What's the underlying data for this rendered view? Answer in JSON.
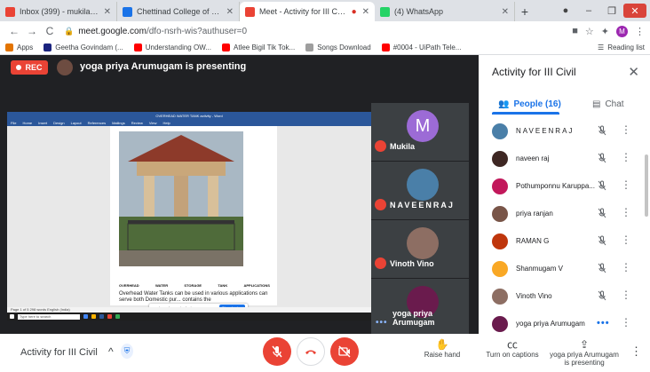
{
  "browser": {
    "tabs": [
      {
        "title": "Inbox (399) - mukila@chettinad.c",
        "icon_color": "#ea4335",
        "active": false
      },
      {
        "title": "Chettinad College of Engineering",
        "icon_color": "#1a73e8",
        "active": false
      },
      {
        "title": "Meet - Activity for III Civil",
        "icon_color": "#ea4335",
        "active": true
      },
      {
        "title": "(4) WhatsApp",
        "icon_color": "#25d366",
        "active": false
      }
    ],
    "url_host": "meet.google.com",
    "url_path": "/dfo-nsrh-wis?authuser=0",
    "profile_letter": "M",
    "bookmarks": [
      {
        "label": "Apps",
        "icon_color": "#e37400"
      },
      {
        "label": "Geetha Govindam (...",
        "icon_color": "#1a237e"
      },
      {
        "label": "Understanding OW...",
        "icon_color": "#ff0000"
      },
      {
        "label": "Atlee Bigil Tik Tok...",
        "icon_color": "#ff0000"
      },
      {
        "label": "Songs Download",
        "icon_color": "#9e9e9e"
      },
      {
        "label": "#0004 - UiPath Tele...",
        "icon_color": "#ff0000"
      }
    ],
    "reading_list": "Reading list"
  },
  "meet": {
    "rec_label": "REC",
    "presenting_text": "yoga priya Arumugam is presenting",
    "meeting_name": "Activity for III Civil"
  },
  "shared_screen": {
    "word_title": "OVERHEAD WATER TANK activity - Word",
    "menu": [
      "File",
      "Home",
      "Insert",
      "Design",
      "Layout",
      "References",
      "Mailings",
      "Review",
      "View",
      "Help"
    ],
    "doc_headings": [
      "OVERHEAD",
      "WATER",
      "STORAGE",
      "TANK",
      "APPLICATIONS"
    ],
    "doc_text": "Overhead Water Tanks can be used in various applications can serve both Domestic pur... contains the",
    "sharing_notice": "meet.google.com is sharing your screen.",
    "stop_sharing": "Stop sharing",
    "status_text": "Page 1 of 5   298 words   English (India)",
    "taskbar_search": "Type here to search"
  },
  "tiles": [
    {
      "name": "Mukila",
      "kind": "letter",
      "letter": "M",
      "color": "#9c6bd6",
      "muted": true
    },
    {
      "name": "NAVEENRAJ",
      "kind": "photo",
      "color": "#4a7fa8",
      "muted": true
    },
    {
      "name": "Vinoth Vino",
      "kind": "photo",
      "color": "#8d6e63",
      "muted": true
    },
    {
      "name": "yoga priya Arumugam",
      "kind": "photo",
      "color": "#6a1b4d",
      "muted": false
    }
  ],
  "panel": {
    "title": "Activity for III Civil",
    "people_tab": "People (16)",
    "chat_tab": "Chat",
    "people": [
      {
        "name": "NAVEENRAJ",
        "avatar_color": "#4a7fa8",
        "muted": true,
        "spaced": true
      },
      {
        "name": "naveen raj",
        "avatar_color": "#3e2723",
        "muted": true,
        "spaced": false
      },
      {
        "name": "Pothumponnu Karuppa...",
        "avatar_color": "#c2185b",
        "muted": true,
        "spaced": false
      },
      {
        "name": "priya ranjan",
        "avatar_color": "#795548",
        "muted": true,
        "spaced": false
      },
      {
        "name": "RAMAN G",
        "avatar_color": "#bf360c",
        "muted": true,
        "spaced": false
      },
      {
        "name": "Shanmugam V",
        "avatar_color": "#f9a825",
        "muted": true,
        "spaced": false
      },
      {
        "name": "Vinoth Vino",
        "avatar_color": "#8d6e63",
        "muted": true,
        "spaced": false
      },
      {
        "name": "yoga priya Arumugam",
        "avatar_color": "#6a1b4d",
        "muted": false,
        "spaced": false
      }
    ]
  },
  "bottom": {
    "raise_hand": "Raise hand",
    "captions": "Turn on captions",
    "presenter_line1": "yoga priya Arumugam",
    "presenter_line2": "is presenting"
  }
}
